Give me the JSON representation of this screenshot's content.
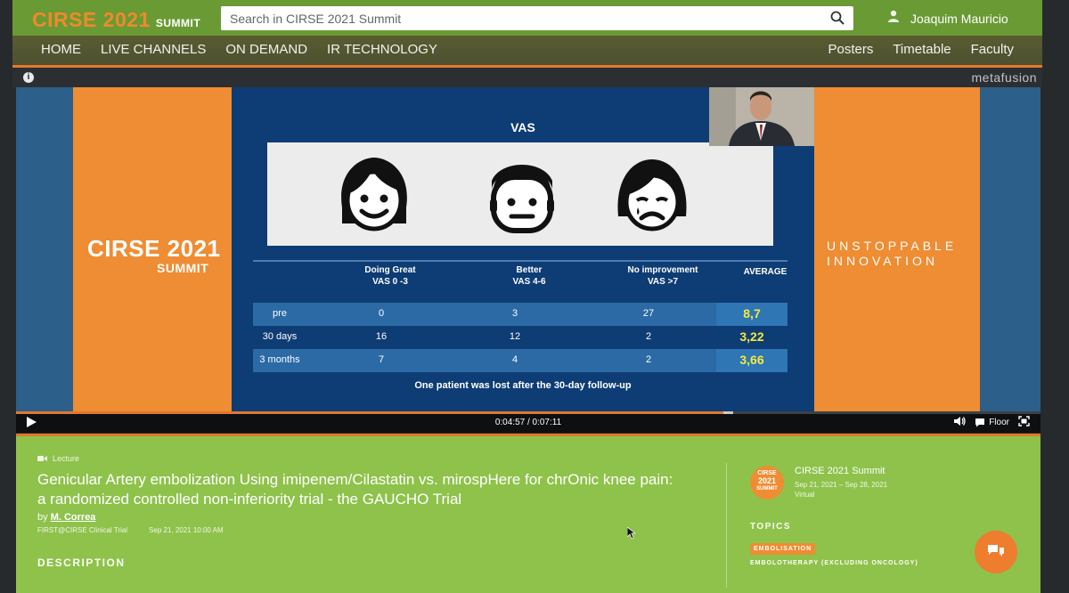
{
  "header": {
    "logo_main": "CIRSE 2021",
    "logo_sub": "SUMMIT",
    "search_placeholder": "Search in CIRSE 2021 Summit",
    "user_name": "Joaquim Mauricio"
  },
  "nav": {
    "left": [
      "HOME",
      "LIVE CHANNELS",
      "ON DEMAND",
      "IR TECHNOLOGY"
    ],
    "right": [
      "Posters",
      "Timetable",
      "Faculty"
    ]
  },
  "brand": "metafusion",
  "slide": {
    "left_logo_main": "CIRSE 2021",
    "left_logo_sub": "SUMMIT",
    "tagline_1": "UNSTOPPABLE",
    "tagline_2": "INNOVATION",
    "title": "VAS",
    "headers": [
      {
        "line1": "Doing Great",
        "line2": "VAS 0 -3"
      },
      {
        "line1": "Better",
        "line2": "VAS 4-6"
      },
      {
        "line1": "No improvement",
        "line2": "VAS >7"
      },
      {
        "line1": "AVERAGE",
        "line2": ""
      }
    ],
    "rows": [
      {
        "label": "pre",
        "c1": "0",
        "c2": "3",
        "c3": "27",
        "avg": "8,7"
      },
      {
        "label": "30 days",
        "c1": "16",
        "c2": "12",
        "c3": "2",
        "avg": "3,22"
      },
      {
        "label": "3 months",
        "c1": "7",
        "c2": "4",
        "c3": "2",
        "avg": "3,66"
      }
    ],
    "note": "One patient was lost after the 30-day follow-up"
  },
  "player": {
    "time": "0:04:57 / 0:07:11",
    "progress_fraction": 0.69,
    "buffer_fraction": 0.7,
    "floor_label": "Floor"
  },
  "lecture": {
    "category": "Lecture",
    "title": "Genicular Artery embolization Using imipenem/Cilastatin vs. mirospHere for chrOnic knee pain: a randomized controlled non-inferiority trial - the GAUCHO Trial",
    "by_prefix": "by",
    "author": "M. Correa",
    "session": "FIRST@CIRSE Clinical Trial",
    "datetime": "Sep 21, 2021 10:00 AM",
    "description_heading": "DESCRIPTION"
  },
  "event": {
    "logo_line1": "CIRSE",
    "logo_line2": "2021",
    "logo_line3": "SUMMIT",
    "name": "CIRSE 2021 Summit",
    "dates": "Sep 21, 2021 – Sep 28, 2021",
    "location": "Virtual",
    "topics_heading": "TOPICS",
    "topics": [
      "EMBOLISATION",
      "EMBOLOTHERAPY (EXCLUDING ONCOLOGY)"
    ]
  },
  "colors": {
    "header_green": "#6a9a34",
    "accent_orange": "#ee8d33",
    "panel_green": "#8ec24b",
    "slide_blue": "#0e3c74",
    "avg_yellow": "#f4e93b"
  }
}
